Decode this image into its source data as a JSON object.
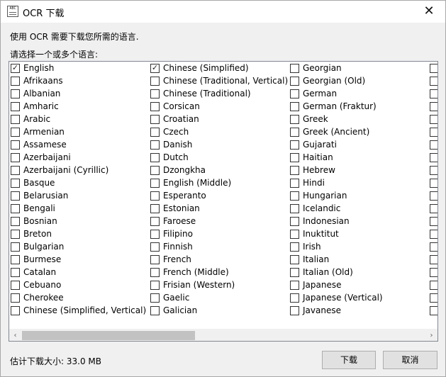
{
  "window": {
    "title": "OCR 下载",
    "close_glyph": "✕",
    "icon_text": "ABC"
  },
  "dialog": {
    "description": "使用 OCR 需要下载您所需的语言.",
    "prompt": "请选择一个或多个语言:",
    "size_info": "估计下载大小: 33.0 MB",
    "download_label": "下载",
    "cancel_label": "取消"
  },
  "scrollbar": {
    "left_glyph": "‹",
    "right_glyph": "›"
  },
  "languages": {
    "col1": [
      {
        "label": "English",
        "checked": true
      },
      {
        "label": "Afrikaans",
        "checked": false
      },
      {
        "label": "Albanian",
        "checked": false
      },
      {
        "label": "Amharic",
        "checked": false
      },
      {
        "label": "Arabic",
        "checked": false
      },
      {
        "label": "Armenian",
        "checked": false
      },
      {
        "label": "Assamese",
        "checked": false
      },
      {
        "label": "Azerbaijani",
        "checked": false
      },
      {
        "label": "Azerbaijani (Cyrillic)",
        "checked": false
      },
      {
        "label": "Basque",
        "checked": false
      },
      {
        "label": "Belarusian",
        "checked": false
      },
      {
        "label": "Bengali",
        "checked": false
      },
      {
        "label": "Bosnian",
        "checked": false
      },
      {
        "label": "Breton",
        "checked": false
      },
      {
        "label": "Bulgarian",
        "checked": false
      },
      {
        "label": "Burmese",
        "checked": false
      },
      {
        "label": "Catalan",
        "checked": false
      },
      {
        "label": "Cebuano",
        "checked": false
      },
      {
        "label": "Cherokee",
        "checked": false
      },
      {
        "label": "Chinese (Simplified, Vertical)",
        "checked": false
      }
    ],
    "col2": [
      {
        "label": "Chinese (Simplified)",
        "checked": true
      },
      {
        "label": "Chinese (Traditional, Vertical)",
        "checked": false
      },
      {
        "label": "Chinese (Traditional)",
        "checked": false
      },
      {
        "label": "Corsican",
        "checked": false
      },
      {
        "label": "Croatian",
        "checked": false
      },
      {
        "label": "Czech",
        "checked": false
      },
      {
        "label": "Danish",
        "checked": false
      },
      {
        "label": "Dutch",
        "checked": false
      },
      {
        "label": "Dzongkha",
        "checked": false
      },
      {
        "label": "English (Middle)",
        "checked": false
      },
      {
        "label": "Esperanto",
        "checked": false
      },
      {
        "label": "Estonian",
        "checked": false
      },
      {
        "label": "Faroese",
        "checked": false
      },
      {
        "label": "Filipino",
        "checked": false
      },
      {
        "label": "Finnish",
        "checked": false
      },
      {
        "label": "French",
        "checked": false
      },
      {
        "label": "French (Middle)",
        "checked": false
      },
      {
        "label": "Frisian (Western)",
        "checked": false
      },
      {
        "label": "Gaelic",
        "checked": false
      },
      {
        "label": "Galician",
        "checked": false
      }
    ],
    "col3": [
      {
        "label": "Georgian",
        "checked": false
      },
      {
        "label": "Georgian (Old)",
        "checked": false
      },
      {
        "label": "German",
        "checked": false
      },
      {
        "label": "German (Fraktur)",
        "checked": false
      },
      {
        "label": "Greek",
        "checked": false
      },
      {
        "label": "Greek (Ancient)",
        "checked": false
      },
      {
        "label": "Gujarati",
        "checked": false
      },
      {
        "label": "Haitian",
        "checked": false
      },
      {
        "label": "Hebrew",
        "checked": false
      },
      {
        "label": "Hindi",
        "checked": false
      },
      {
        "label": "Hungarian",
        "checked": false
      },
      {
        "label": "Icelandic",
        "checked": false
      },
      {
        "label": "Indonesian",
        "checked": false
      },
      {
        "label": "Inuktitut",
        "checked": false
      },
      {
        "label": "Irish",
        "checked": false
      },
      {
        "label": "Italian",
        "checked": false
      },
      {
        "label": "Italian (Old)",
        "checked": false
      },
      {
        "label": "Japanese",
        "checked": false
      },
      {
        "label": "Japanese (Vertical)",
        "checked": false
      },
      {
        "label": "Javanese",
        "checked": false
      }
    ],
    "col4": [
      {
        "label": "",
        "checked": false
      },
      {
        "label": "",
        "checked": false
      },
      {
        "label": "",
        "checked": false
      },
      {
        "label": "",
        "checked": false
      },
      {
        "label": "",
        "checked": false
      },
      {
        "label": "",
        "checked": false
      },
      {
        "label": "",
        "checked": false
      },
      {
        "label": "",
        "checked": false
      },
      {
        "label": "",
        "checked": false
      },
      {
        "label": "",
        "checked": false
      },
      {
        "label": "",
        "checked": false
      },
      {
        "label": "",
        "checked": false
      },
      {
        "label": "",
        "checked": false
      },
      {
        "label": "",
        "checked": false
      },
      {
        "label": "",
        "checked": false
      },
      {
        "label": "",
        "checked": false
      },
      {
        "label": "",
        "checked": false
      },
      {
        "label": "",
        "checked": false
      },
      {
        "label": "",
        "checked": false
      },
      {
        "label": "",
        "checked": false
      }
    ]
  }
}
